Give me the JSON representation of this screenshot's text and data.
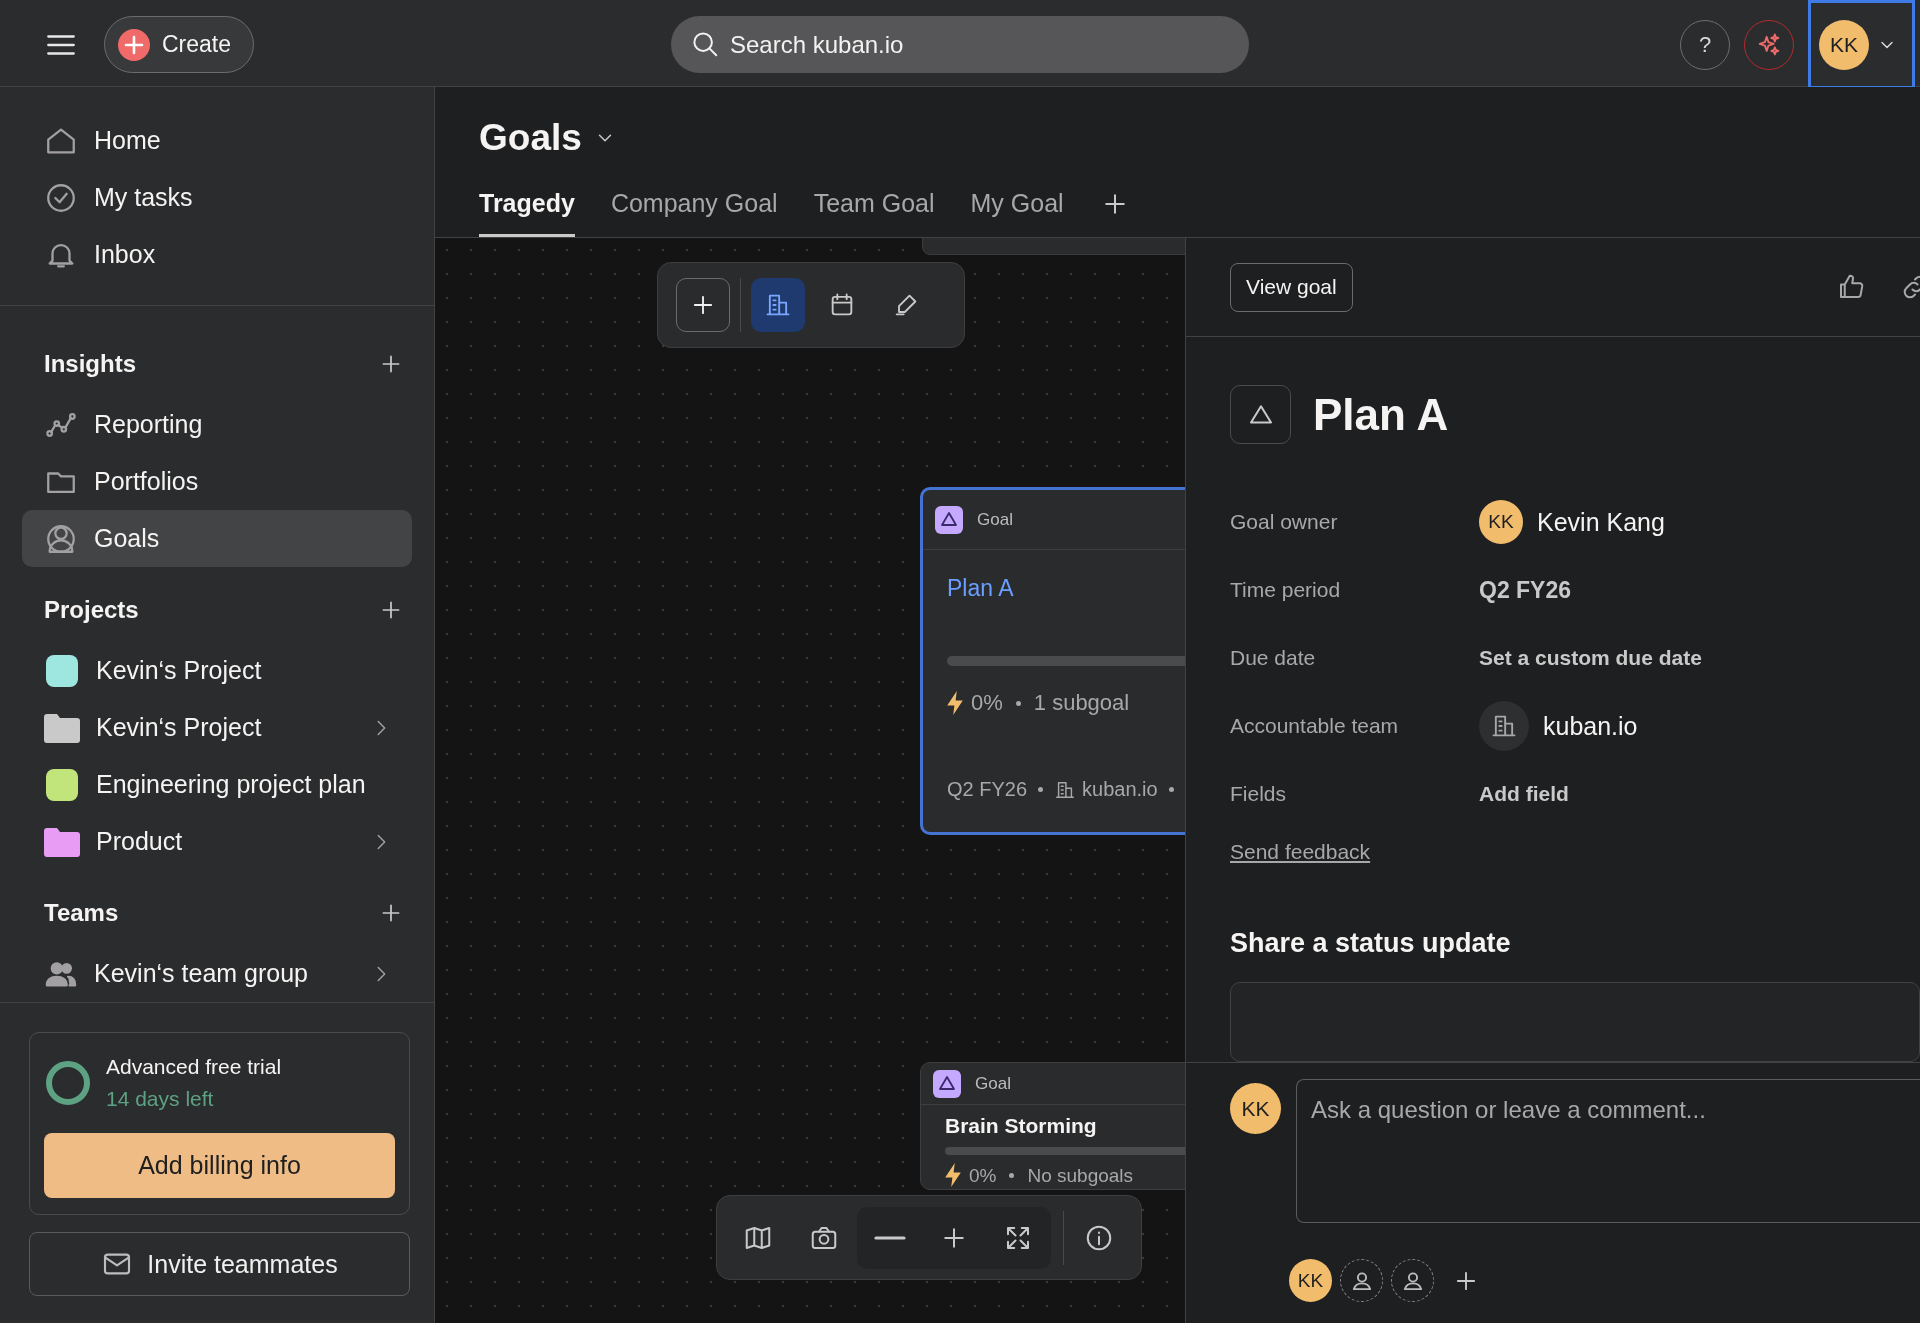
{
  "topbar": {
    "create_label": "Create",
    "search": {
      "placeholder": "Search kuban.io"
    },
    "help_label": "?",
    "avatar": {
      "initials": "KK",
      "focused": true
    }
  },
  "sidebar": {
    "nav": [
      {
        "kind": "home",
        "label": "Home",
        "selected": false
      },
      {
        "kind": "tasks",
        "label": "My tasks",
        "selected": false
      },
      {
        "kind": "inbox",
        "label": "Inbox",
        "selected": false
      }
    ],
    "sections": [
      {
        "title": "Insights",
        "items": [
          {
            "kind": "reporting",
            "label": "Reporting",
            "selected": false,
            "expandable": false
          },
          {
            "kind": "portfolios",
            "label": "Portfolios",
            "selected": false,
            "expandable": false
          },
          {
            "kind": "goals",
            "label": "Goals",
            "selected": true,
            "expandable": false
          }
        ]
      },
      {
        "title": "Projects",
        "items": [
          {
            "kind": "project",
            "label": "Kevin‘s Project",
            "color": "#9ee7e0",
            "selected": false,
            "expandable": false
          },
          {
            "kind": "folder",
            "label": "Kevin‘s Project",
            "color": "#c9c9c9",
            "selected": false,
            "expandable": true
          },
          {
            "kind": "project",
            "label": "Engineering project plan",
            "color": "#c1e57b",
            "selected": false,
            "expandable": false
          },
          {
            "kind": "folder",
            "label": "Product",
            "color": "#e99cf3",
            "selected": false,
            "expandable": true
          }
        ]
      },
      {
        "title": "Teams",
        "items": [
          {
            "kind": "team",
            "label": "Kevin‘s team group",
            "selected": false,
            "expandable": true
          }
        ]
      }
    ],
    "trial": {
      "title": "Advanced free trial",
      "days_left": "14 days left",
      "billing_button": "Add billing info"
    },
    "invite_button": "Invite teammates"
  },
  "header": {
    "title": "Goals",
    "tabs": [
      {
        "label": "Tragedy",
        "selected": true
      },
      {
        "label": "Company Goal",
        "selected": false
      },
      {
        "label": "Team Goal",
        "selected": false
      },
      {
        "label": "My Goal",
        "selected": false
      }
    ]
  },
  "canvas": {
    "toolbar": [
      {
        "kind": "add",
        "selected": false
      },
      {
        "kind": "hierarchy",
        "selected": true
      },
      {
        "kind": "calendar",
        "selected": false
      },
      {
        "kind": "draw",
        "selected": false
      }
    ],
    "cards": [
      {
        "type_label": "Goal",
        "title": "Plan A",
        "selected": true,
        "progress": "0%",
        "subgoals": "1 subgoal",
        "period": "Q2 FY26",
        "team": "kuban.io"
      },
      {
        "type_label": "Goal",
        "title": "Brain Storming",
        "selected": false,
        "progress": "0%",
        "subgoals": "No subgoals"
      }
    ],
    "bottom_toolbar": [
      {
        "kind": "plain",
        "tools": [
          {
            "kind": "map"
          },
          {
            "kind": "camera"
          }
        ]
      },
      {
        "kind": "shaded",
        "tools": [
          {
            "kind": "zoom_out"
          },
          {
            "kind": "zoom_in"
          },
          {
            "kind": "fit"
          }
        ]
      },
      {
        "kind": "divided",
        "tools": [
          {
            "kind": "info"
          }
        ]
      }
    ]
  },
  "panel": {
    "view_button": "View goal",
    "title": "Plan A",
    "fields": [
      {
        "kind": "person",
        "label": "Goal owner",
        "initials": "KK",
        "value": "Kevin Kang"
      },
      {
        "kind": "plain",
        "label": "Time period",
        "value": "Q2 FY26"
      },
      {
        "kind": "action",
        "label": "Due date",
        "value": "Set a custom due date"
      },
      {
        "kind": "team",
        "label": "Accountable team",
        "value": "kuban.io"
      },
      {
        "kind": "action",
        "label": "Fields",
        "value": "Add field"
      }
    ],
    "feedback_link": "Send feedback",
    "status_heading": "Share a status update",
    "comment": {
      "initials": "KK",
      "placeholder": "Ask a question or leave a comment..."
    },
    "collaborators": [
      {
        "kind": "user",
        "initials": "KK"
      },
      {
        "kind": "empty"
      },
      {
        "kind": "empty"
      }
    ]
  }
}
